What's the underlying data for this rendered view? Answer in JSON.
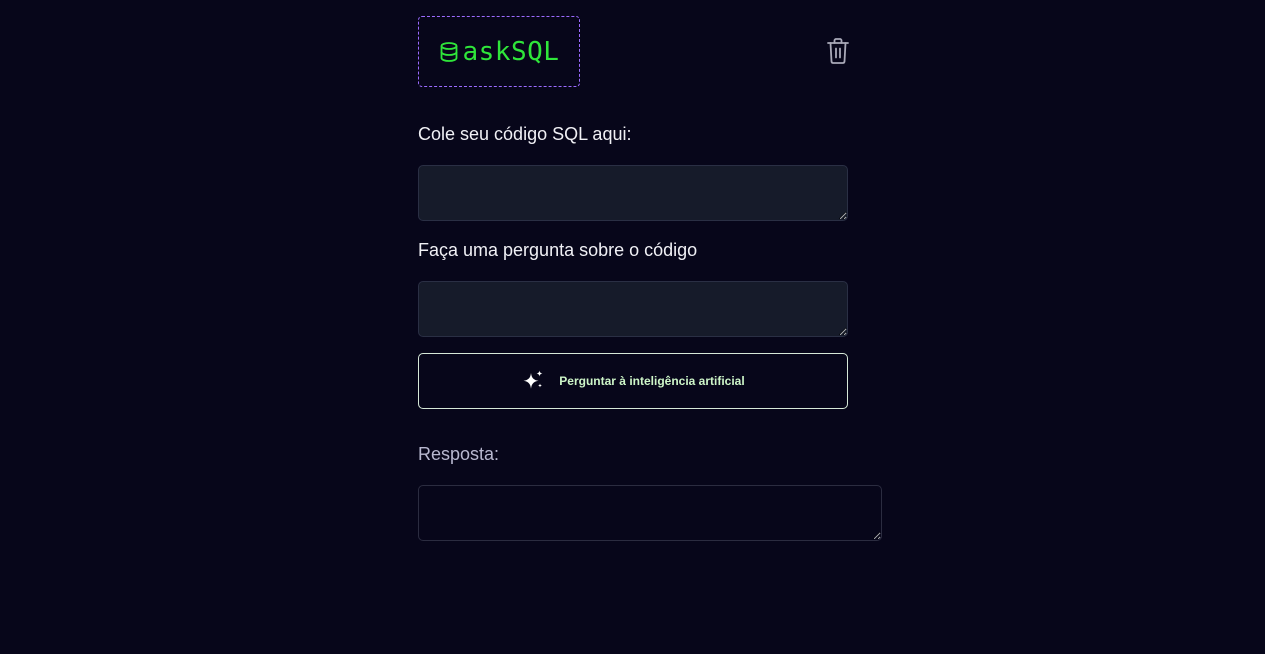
{
  "header": {
    "logo_text": "askSQL",
    "logo_icon": "database-icon",
    "trash_icon": "trash-icon"
  },
  "form": {
    "sql_label": "Cole seu código SQL aqui:",
    "sql_value": "",
    "question_label": "Faça uma pergunta sobre o código",
    "question_value": "",
    "ask_button_label": "Perguntar à inteligência artificial",
    "ask_button_icon": "sparkles-icon"
  },
  "answer": {
    "label": "Resposta:",
    "value": ""
  },
  "colors": {
    "background": "#07061a",
    "logo_green": "#2fe63a",
    "logo_border": "#9b6bff",
    "input_bg": "#161b2a"
  }
}
